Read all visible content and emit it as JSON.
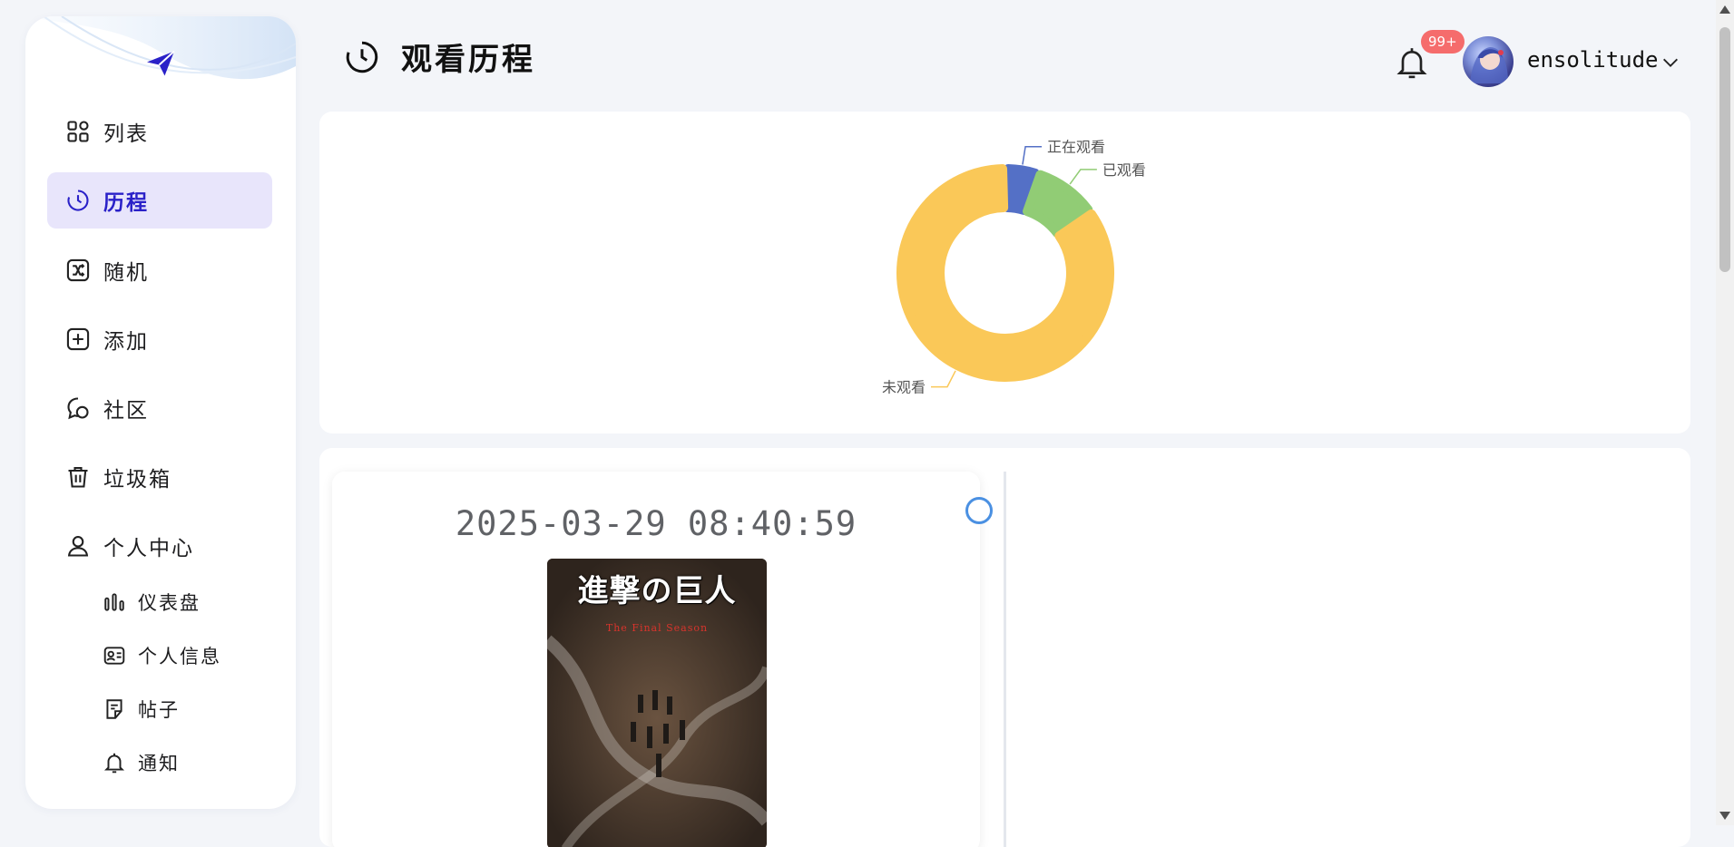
{
  "sidebar": {
    "items": [
      {
        "label": "列表",
        "icon": "grid-icon"
      },
      {
        "label": "历程",
        "icon": "clock-icon"
      },
      {
        "label": "随机",
        "icon": "shuffle-icon"
      },
      {
        "label": "添加",
        "icon": "plus-square-icon"
      },
      {
        "label": "社区",
        "icon": "chat-bubble-icon"
      },
      {
        "label": "垃圾箱",
        "icon": "trash-icon"
      },
      {
        "label": "个人中心",
        "icon": "user-icon"
      }
    ],
    "sub_items": [
      {
        "label": "仪表盘",
        "icon": "bar-chart-icon"
      },
      {
        "label": "个人信息",
        "icon": "id-card-icon"
      },
      {
        "label": "帖子",
        "icon": "note-icon"
      },
      {
        "label": "通知",
        "icon": "bell-icon"
      }
    ],
    "active_item": "历程"
  },
  "header": {
    "title": "观看历程",
    "notification_badge": "99+",
    "username": "ensolitude"
  },
  "chart_data": {
    "type": "pie",
    "categories": [
      "正在观看",
      "已观看",
      "未观看"
    ],
    "values": [
      5,
      10,
      85
    ],
    "colors": [
      "#5470c6",
      "#91cc75",
      "#fac858"
    ]
  },
  "timeline": {
    "entries": [
      {
        "time": "2025-03-29 08:40:59",
        "poster_title": "進撃の巨人",
        "poster_subtitle": "The Final Season"
      }
    ]
  },
  "colors": {
    "accent": "#2a21c8",
    "active_bg": "#e8e5fb",
    "badge": "#f56c6c",
    "timeline_node": "#4a90e2"
  }
}
